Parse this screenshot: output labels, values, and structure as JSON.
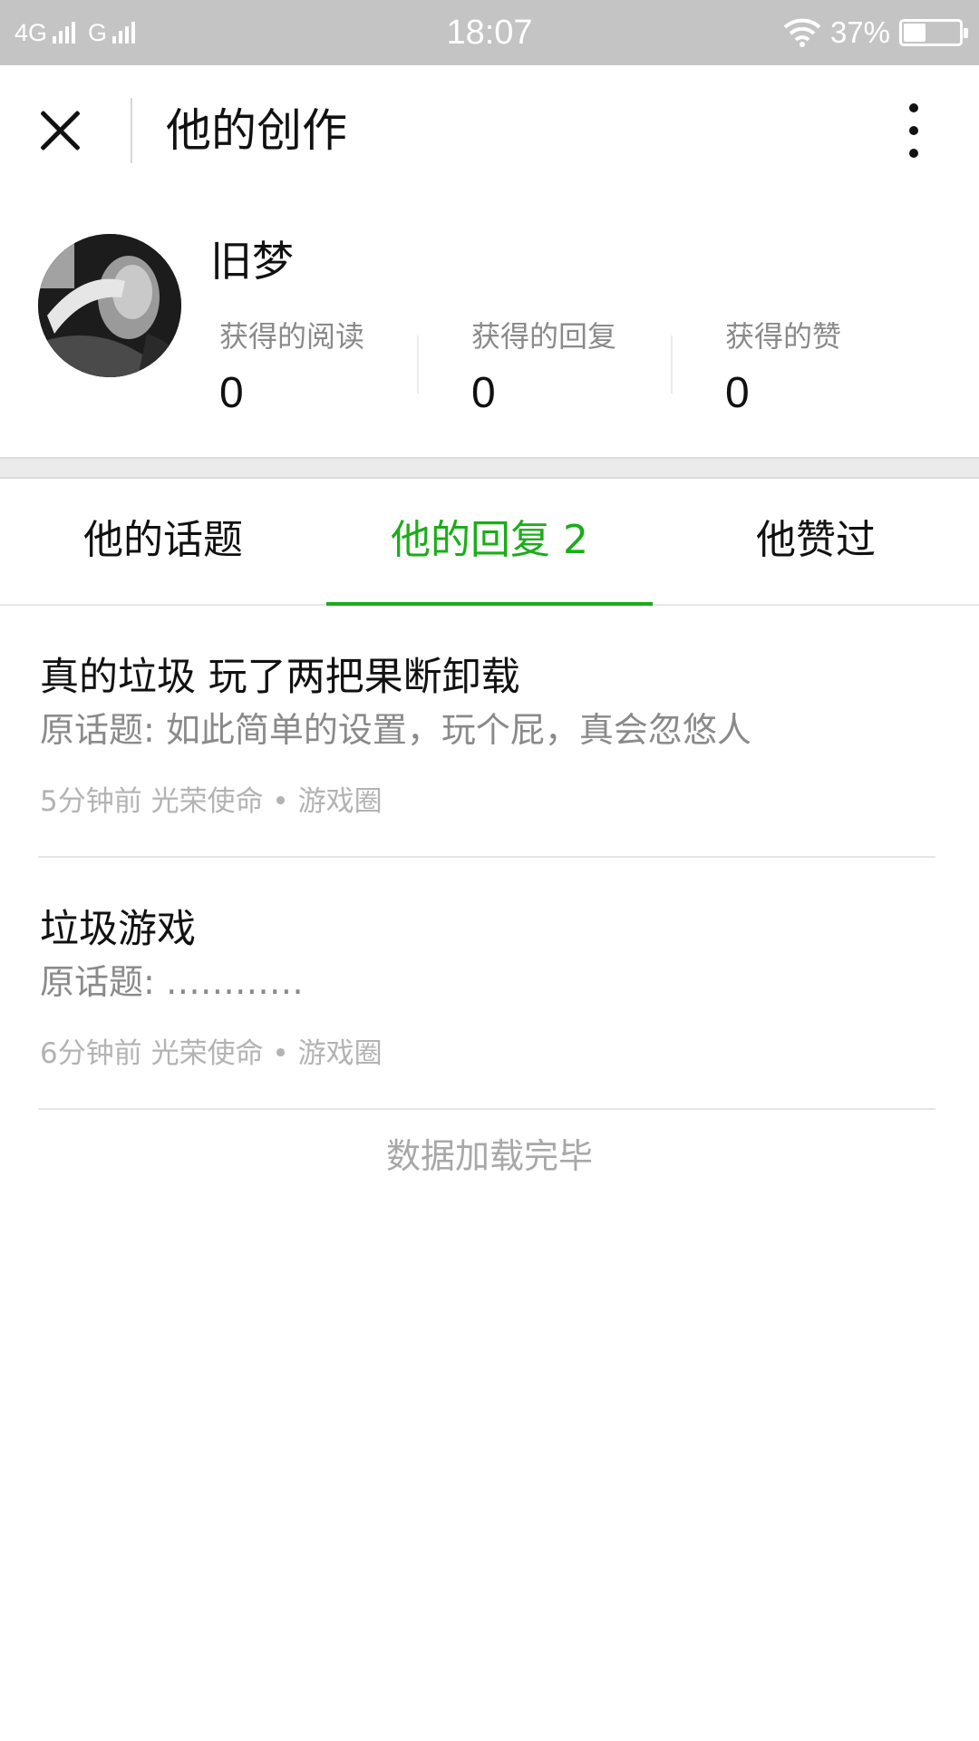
{
  "status_bar": {
    "network_1": "4G",
    "network_2": "G",
    "time": "18:07",
    "battery_text": "37%",
    "battery_level": 0.37
  },
  "nav": {
    "title": "他的创作",
    "close_icon": "close-icon",
    "more_icon": "more-vertical-icon"
  },
  "profile": {
    "username": "旧梦",
    "stats": [
      {
        "label": "获得的阅读",
        "value": "0"
      },
      {
        "label": "获得的回复",
        "value": "0"
      },
      {
        "label": "获得的赞",
        "value": "0"
      }
    ]
  },
  "tabs": [
    {
      "label": "他的话题"
    },
    {
      "label": "他的回复 2"
    },
    {
      "label": "他赞过"
    }
  ],
  "active_tab": 1,
  "replies": [
    {
      "title": "真的垃圾 玩了两把果断卸载",
      "origin": "原话题: 如此简单的设置，玩个屁，真会忽悠人",
      "meta": "5分钟前 光荣使命 • 游戏圈"
    },
    {
      "title": "垃圾游戏",
      "origin": "原话题: …………",
      "meta": "6分钟前 光荣使命 • 游戏圈"
    }
  ],
  "footer": {
    "load_complete": "数据加载完毕"
  },
  "colors": {
    "accent": "#1aad19",
    "status_bar": "#c4c4c4",
    "secondary_text": "#8a8a8a"
  }
}
